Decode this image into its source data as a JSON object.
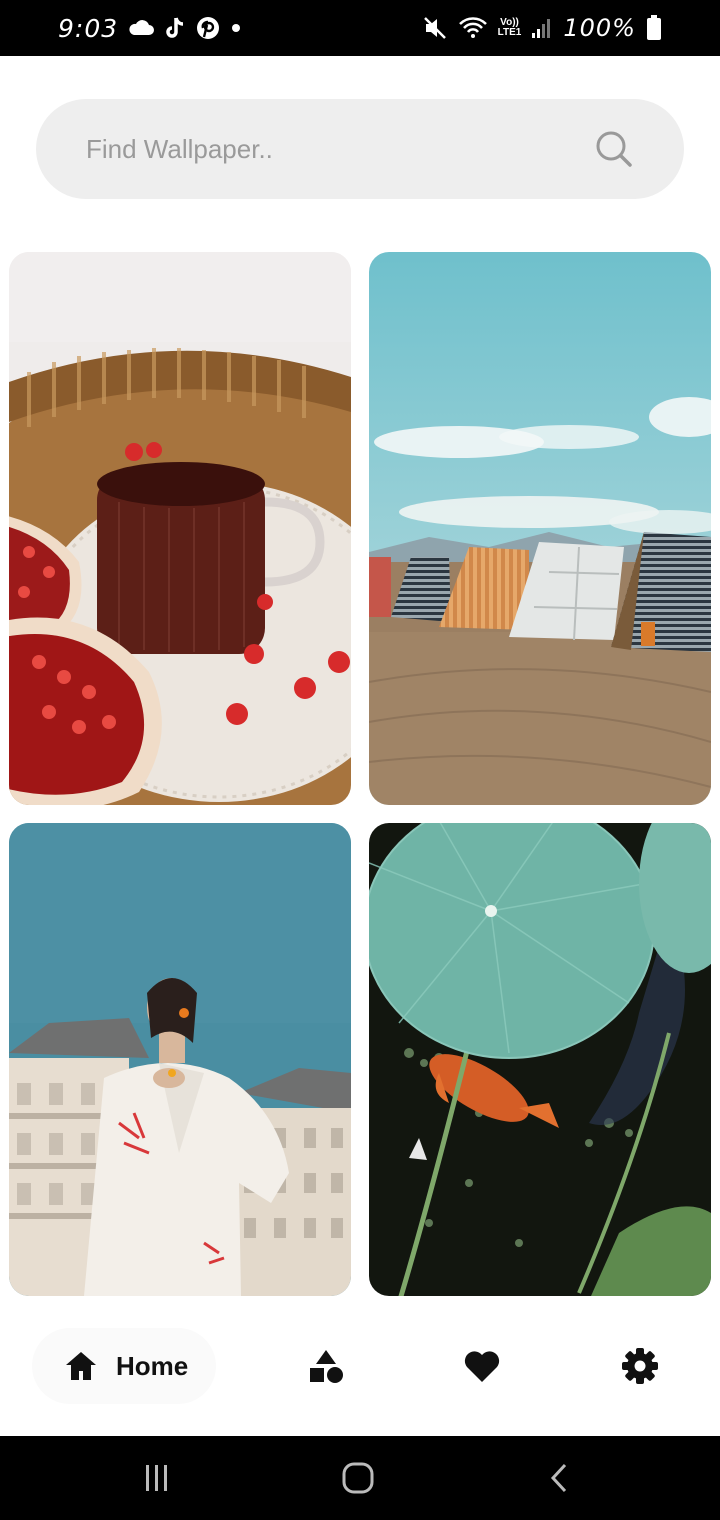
{
  "status_bar": {
    "time": "9:03",
    "lte_top": "Vo))",
    "lte_bottom": "LTE1",
    "battery": "100%",
    "icons": [
      "cloud-icon",
      "tiktok-icon",
      "pinterest-icon",
      "dot-icon",
      "mute-icon",
      "wifi-icon",
      "signal-icon",
      "battery-icon"
    ]
  },
  "search": {
    "placeholder": "Find Wallpaper..",
    "value": "",
    "icon": "search-icon"
  },
  "wallpapers": [
    {
      "subject": "pomegranate-tea",
      "icon": "image"
    },
    {
      "subject": "beach-tents",
      "icon": "image"
    },
    {
      "subject": "woman-building",
      "icon": "image"
    },
    {
      "subject": "lotus-koi",
      "icon": "image"
    }
  ],
  "bottom_nav": {
    "home_label": "Home",
    "items": [
      "home-icon",
      "categories-icon",
      "heart-icon",
      "settings-icon"
    ]
  },
  "system_nav": [
    "recents-icon",
    "home-circle-icon",
    "back-icon"
  ],
  "colors": {
    "search_bg": "#eeeeee",
    "text_dark": "#111111",
    "placeholder": "#9a9a9a"
  }
}
